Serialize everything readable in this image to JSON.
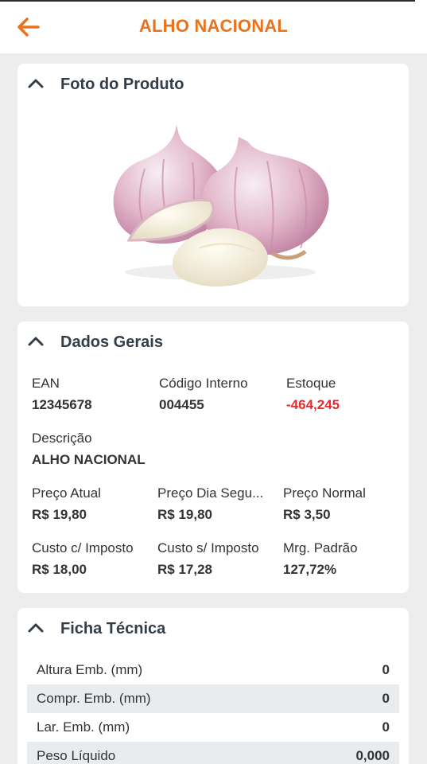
{
  "app": {
    "title": "ALHO NACIONAL",
    "accent_color": "#e8731c",
    "back_icon": "arrow-left-icon"
  },
  "photo": {
    "section_title": "Foto do Produto",
    "image_subject": "garlic bulbs"
  },
  "dados": {
    "section_title": "Dados Gerais",
    "fields": [
      {
        "label": "EAN",
        "value": "12345678"
      },
      {
        "label": "Código Interno",
        "value": "004455"
      },
      {
        "label": "Estoque",
        "value": "-464,245",
        "color": "#e52b2b"
      },
      {
        "label": "Descrição",
        "value": "ALHO NACIONAL"
      },
      {
        "label": "Preço Atual",
        "value": "R$ 19,80"
      },
      {
        "label": "Preço Dia Segu...",
        "value": "R$ 19,80"
      },
      {
        "label": "Preço Normal",
        "value": "R$ 3,50"
      },
      {
        "label": "Custo c/ Imposto",
        "value": "R$ 18,00"
      },
      {
        "label": "Custo s/ Imposto",
        "value": "R$ 17,28"
      },
      {
        "label": "Mrg. Padrão",
        "value": "127,72%"
      }
    ]
  },
  "ficha": {
    "section_title": "Ficha Técnica",
    "rows": [
      {
        "label": "Altura Emb. (mm)",
        "value": "0"
      },
      {
        "label": "Compr. Emb. (mm)",
        "value": "0"
      },
      {
        "label": "Lar. Emb. (mm)",
        "value": "0"
      },
      {
        "label": "Peso Líquido",
        "value": "0,000"
      }
    ]
  }
}
